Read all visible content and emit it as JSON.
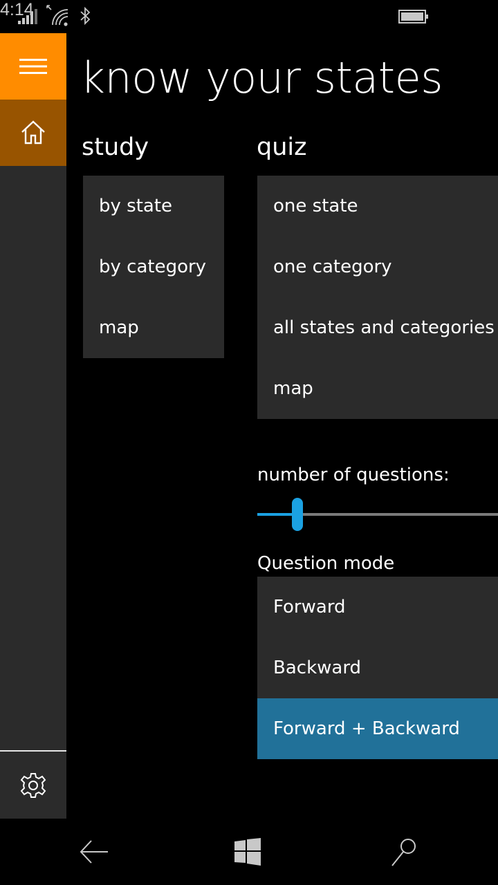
{
  "status_bar": {
    "time": "4:14",
    "icons": [
      "signal-icon",
      "wifi-icon",
      "bluetooth-icon",
      "battery-icon"
    ],
    "battery_level": 1.0
  },
  "nav_rail": {
    "menu_icon": "hamburger-icon",
    "home_icon": "home-icon",
    "settings_icon": "gear-icon",
    "menu_color": "#ff8c00",
    "home_color": "#985400"
  },
  "page": {
    "title": "know your states"
  },
  "study": {
    "header": "study",
    "items": [
      {
        "label": "by state"
      },
      {
        "label": "by category"
      },
      {
        "label": "map"
      }
    ]
  },
  "quiz": {
    "header": "quiz",
    "items": [
      {
        "label": "one state"
      },
      {
        "label": "one category"
      },
      {
        "label": "all states and categories"
      },
      {
        "label": "map"
      }
    ],
    "questions_label": "number of questions:",
    "questions_slider_fraction": 0.16,
    "mode_label": "Question mode",
    "modes": [
      {
        "label": "Forward",
        "selected": false
      },
      {
        "label": "Backward",
        "selected": false
      },
      {
        "label": "Forward + Backward",
        "selected": true
      }
    ],
    "accent_color": "#1ba1e2",
    "selected_color": "#217199"
  },
  "system_nav": {
    "back_icon": "back-arrow-icon",
    "start_icon": "windows-logo-icon",
    "search_icon": "search-icon"
  }
}
